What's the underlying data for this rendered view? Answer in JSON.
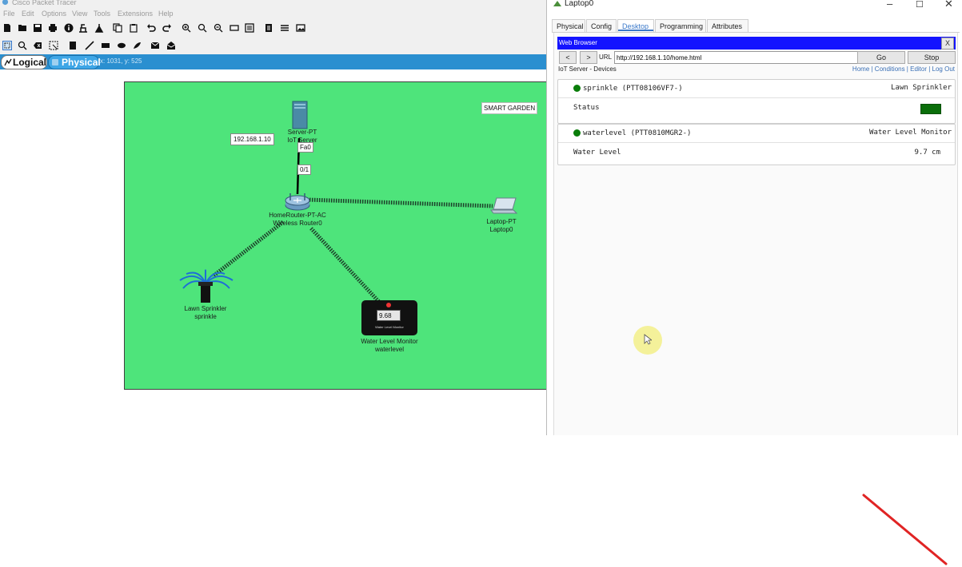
{
  "app": {
    "title": "Cisco Packet Tracer",
    "menu": [
      "File",
      "Edit",
      "Options",
      "View",
      "Tools",
      "Extensions",
      "Help"
    ],
    "mode_logical": "Logical",
    "mode_physical": "Physical",
    "coords": "x: 1031, y: 525"
  },
  "topology": {
    "title_label": "SMART GARDEN",
    "ip_tag": "192.168.1.10",
    "server_label_1": "Server-PT",
    "server_label_2": "IoT Server",
    "port_fa0": "Fa0",
    "port_01": "0/1",
    "router_label_1": "HomeRouter-PT-AC",
    "router_label_2": "Wireless Router0",
    "laptop_label_1": "Laptop-PT",
    "laptop_label_2": "Laptop0",
    "sprinkler_label_1": "Lawn Sprinkler",
    "sprinkler_label_2": "sprinkle",
    "monitor_label_1": "Water Level Monitor",
    "monitor_label_2": "waterlevel",
    "monitor_display": "9.68",
    "monitor_caption": "Water Level Monitor"
  },
  "laptop": {
    "title": "Laptop0",
    "tabs": [
      "Physical",
      "Config",
      "Desktop",
      "Programming",
      "Attributes"
    ],
    "active_tab": "Desktop",
    "browser": {
      "title": "Web Browser",
      "close": "X",
      "back": "<",
      "forward": ">",
      "url_label": "URL",
      "url": "http://192.168.1.10/home.html",
      "go": "Go",
      "stop": "Stop"
    },
    "iot": {
      "heading": "IoT Server - Devices",
      "links": "Home | Conditions | Editor | Log Out",
      "devices": [
        {
          "name": "sprinkle (PTT08106VF7-)",
          "type": "Lawn Sprinkler",
          "field": "Status",
          "value": "",
          "status_color": "#0a6e0a"
        },
        {
          "name": "waterlevel (PTT0810MGR2-)",
          "type": "Water Level Monitor",
          "field": "Water Level",
          "value": "9.7 cm"
        }
      ]
    }
  },
  "colors": {
    "canvas": "#4ee47b",
    "modebar": "#2a8fd0",
    "browser_bar": "#1414ff",
    "status_on": "#0a7d0a",
    "annotation": "#e02424"
  }
}
